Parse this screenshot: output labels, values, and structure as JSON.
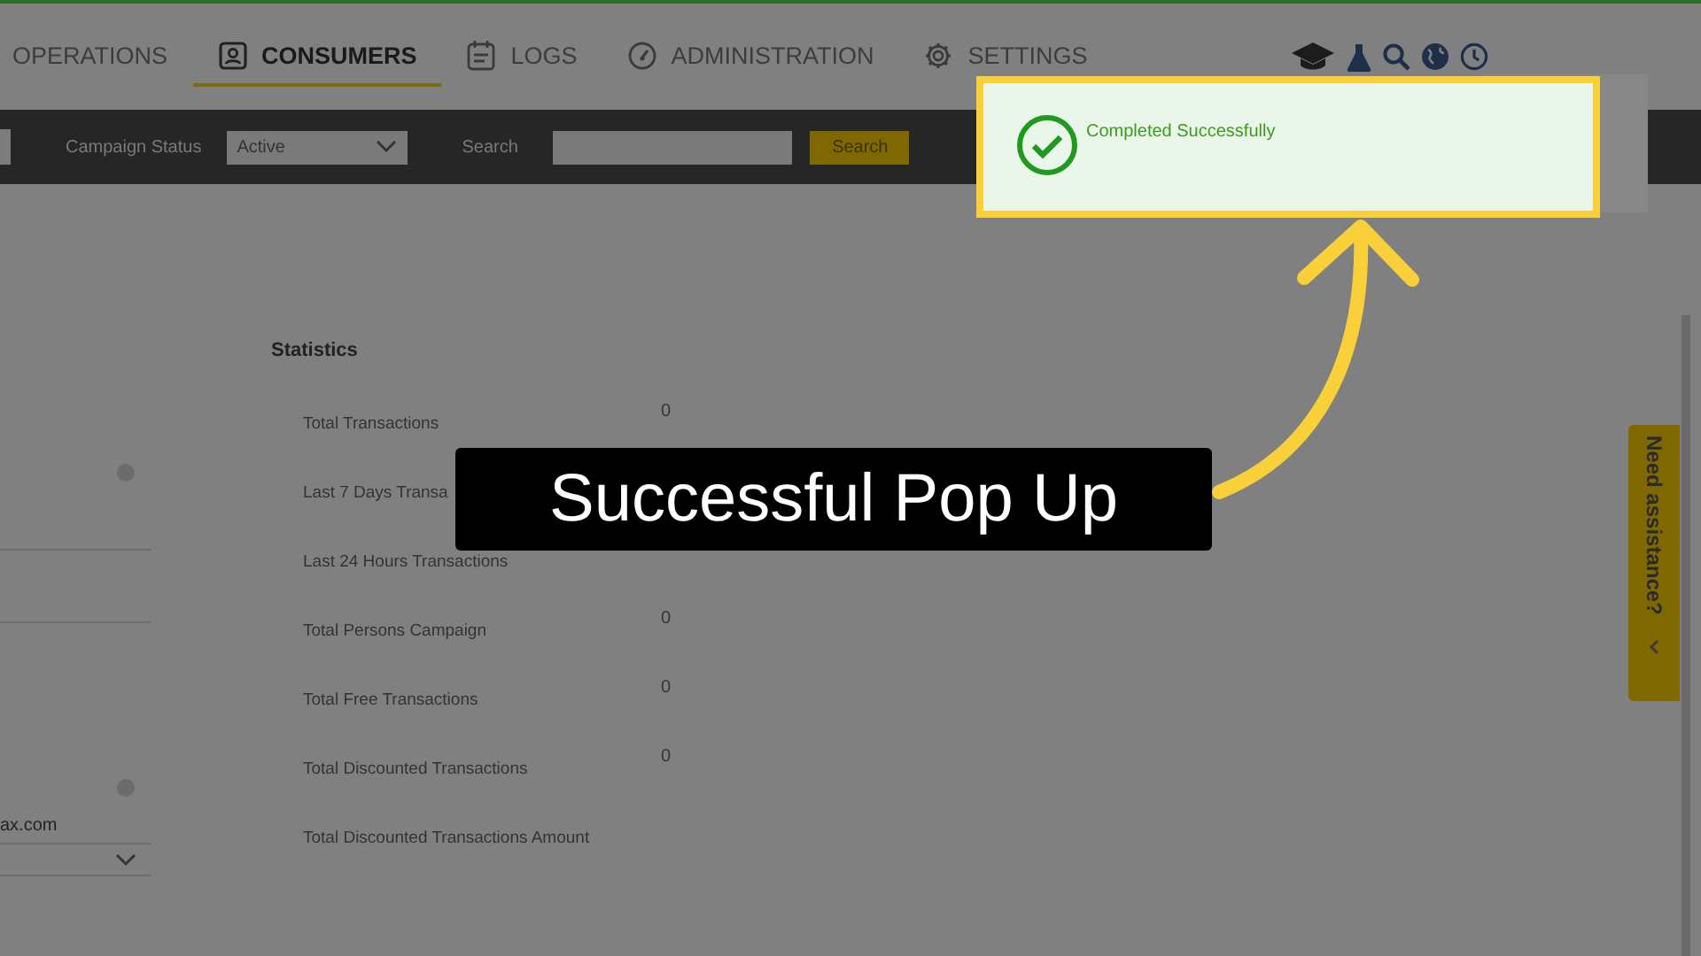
{
  "nav": {
    "tabs": [
      {
        "label": "OPERATIONS",
        "selected": false
      },
      {
        "label": "CONSUMERS",
        "selected": true
      },
      {
        "label": "LOGS",
        "selected": false
      },
      {
        "label": "ADMINISTRATION",
        "selected": false
      },
      {
        "label": "SETTINGS",
        "selected": false
      }
    ]
  },
  "toolbar": {
    "status_label": "Campaign Status",
    "status_value": "Active",
    "search_label": "Search",
    "search_button": "Search"
  },
  "left_fields": {
    "email_value": "ax.com"
  },
  "statistics": {
    "title": "Statistics",
    "rows": [
      {
        "label": "Total Transactions",
        "value": "0"
      },
      {
        "label": "Last 7 Days Transa"
      },
      {
        "label": "Last 24 Hours Transactions"
      },
      {
        "label": "Total Persons Campaign",
        "value": "0"
      },
      {
        "label": "Total Free Transactions",
        "value": "0"
      },
      {
        "label": "Total Discounted Transactions",
        "value": "0"
      },
      {
        "label": "Total Discounted Transactions Amount"
      }
    ]
  },
  "toast": {
    "message": "Completed Successfully"
  },
  "help_tab": {
    "label": "Need assistance?"
  },
  "annotation": {
    "label": "Successful Pop Up"
  }
}
